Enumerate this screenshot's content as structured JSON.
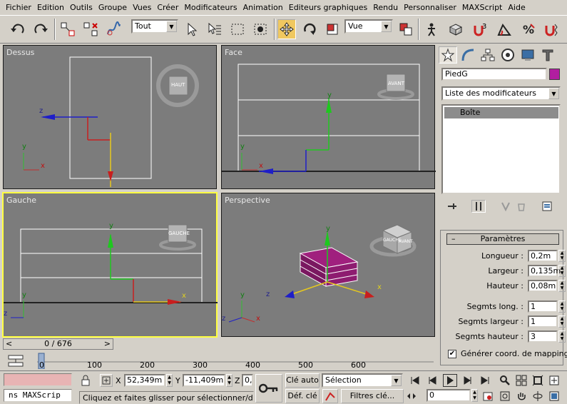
{
  "menu": {
    "items": [
      "Fichier",
      "Edition",
      "Outils",
      "Groupe",
      "Vues",
      "Créer",
      "Modificateurs",
      "Animation",
      "Editeurs graphiques",
      "Rendu",
      "Personnaliser",
      "MAXScript",
      "Aide"
    ]
  },
  "toolbar": {
    "selection_filter": "Tout",
    "reference_coord": "Vue"
  },
  "viewports": {
    "top_label": "Dessus",
    "front_label": "Face",
    "left_label": "Gauche",
    "perspective_label": "Perspective",
    "top_cube": "HAUT",
    "front_cube": "AVANT",
    "left_cube": "GAUCHE",
    "persp_cube_front": "AVANT",
    "persp_cube_side": "GAUCHE"
  },
  "axes": {
    "x": "x",
    "y": "y",
    "z": "z"
  },
  "command_panel": {
    "object_name": "PiedG",
    "object_color": "#b21ea0",
    "modifier_list": "Liste des modificateurs",
    "stack_item": "Boîte",
    "rollout_title": "Paramètres",
    "params": [
      {
        "label": "Longueur :",
        "value": "0,2m"
      },
      {
        "label": "Largeur :",
        "value": "0,135m"
      },
      {
        "label": "Hauteur :",
        "value": "0,08m"
      },
      {
        "label": "Segmts long. :",
        "value": "1"
      },
      {
        "label": "Segmts largeur :",
        "value": "1"
      },
      {
        "label": "Segmts hauteur :",
        "value": "3"
      }
    ],
    "gen_mapping": "Générer coord. de mapping",
    "gen_mapping_checked": "✔"
  },
  "timeline": {
    "slider_text": "0 / 676",
    "ticks": [
      "0",
      "100",
      "200",
      "300",
      "400",
      "500",
      "600"
    ]
  },
  "status": {
    "maxscript_text": "ns MAXScrip",
    "x_label": "X",
    "x_value": "52,349m",
    "y_label": "Y",
    "y_value": "-11,409m",
    "z_label": "Z",
    "z_value": "0,",
    "prompt": "Cliquez et faites glisser pour sélectionner/déplacer",
    "auto_key": "Clé auto",
    "set_key": "Déf. clé",
    "key_filter_select": "Sélection",
    "key_filters": "Filtres clé...",
    "frame": "0"
  }
}
